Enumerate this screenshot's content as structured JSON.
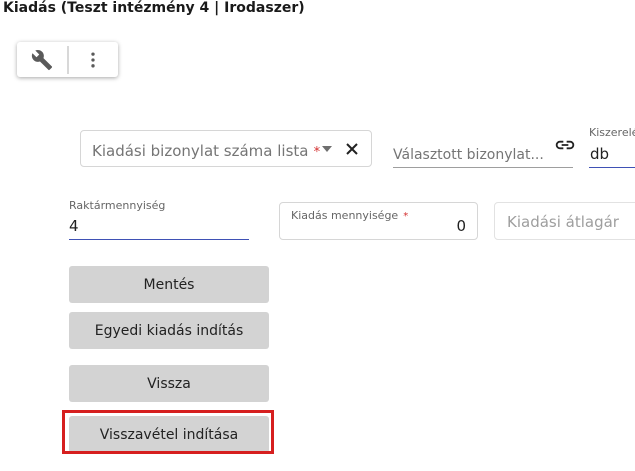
{
  "page": {
    "title": "Kiadás (Teszt intézmény 4 | Irodaszer)"
  },
  "toolbar": {
    "wrench_icon": "wrench-icon",
    "more_icon": "more-vert-icon"
  },
  "form": {
    "document_list": {
      "placeholder": "Kiadási bizonylat száma lista",
      "required_mark": "*"
    },
    "selected_document": {
      "placeholder": "Választott bizonylat..."
    },
    "packaging": {
      "label": "Kiszerelé",
      "value": "db"
    },
    "stock_quantity": {
      "label": "Raktármennyiség",
      "value": "4"
    },
    "issue_quantity": {
      "label": "Kiadás mennyisége",
      "required_mark": "*",
      "value": "0"
    },
    "avg_price": {
      "placeholder": "Kiadási átlagár"
    }
  },
  "buttons": {
    "save": "Mentés",
    "single_issue": "Egyedi kiadás indítás",
    "back": "Vissza",
    "return_start": "Visszavétel indítása"
  },
  "colors": {
    "highlight": "#d61f1f",
    "required": "#d32f2f",
    "button_bg": "#d3d3d3",
    "focus_underline": "#3f51b5"
  }
}
